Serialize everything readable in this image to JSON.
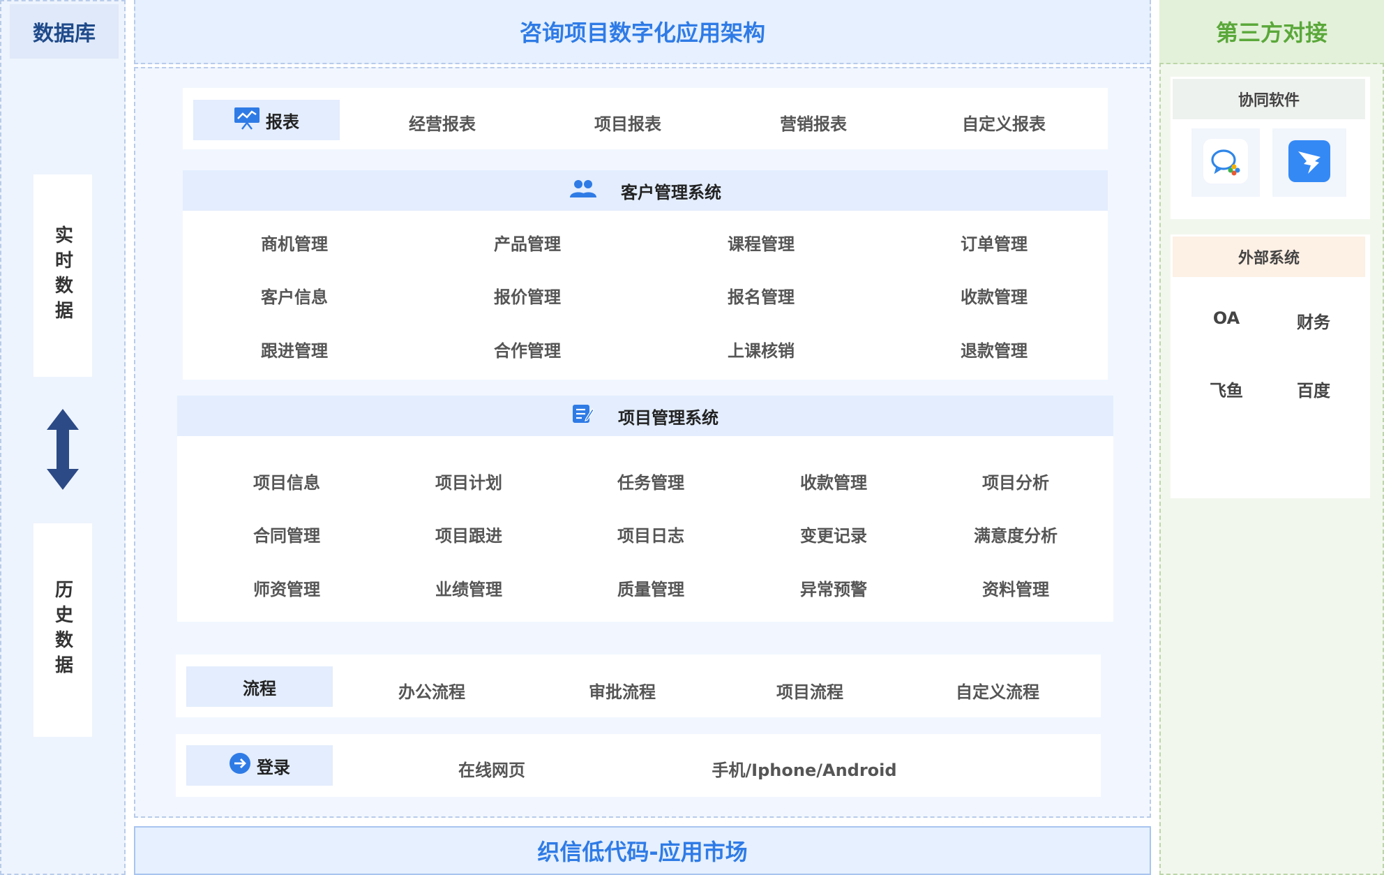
{
  "left": {
    "title": "数据库",
    "realtime": "实时数据",
    "history": "历史数据",
    "arrow_icon": "double-arrow-vertical-icon"
  },
  "center": {
    "title": "咨询项目数字化应用架构",
    "footer": "织信低代码-应用市场",
    "reports": {
      "icon": "presentation-chart-icon",
      "label": "报表",
      "items": [
        "经营报表",
        "项目报表",
        "营销报表",
        "自定义报表"
      ]
    },
    "crm": {
      "icon": "users-icon",
      "title": "客户管理系统",
      "rows": [
        [
          "商机管理",
          "产品管理",
          "课程管理",
          "订单管理"
        ],
        [
          "客户信息",
          "报价管理",
          "报名管理",
          "收款管理"
        ],
        [
          "跟进管理",
          "合作管理",
          "上课核销",
          "退款管理"
        ]
      ]
    },
    "pm": {
      "icon": "edit-list-icon",
      "title": "项目管理系统",
      "rows": [
        [
          "项目信息",
          "项目计划",
          "任务管理",
          "收款管理",
          "项目分析"
        ],
        [
          "合同管理",
          "项目跟进",
          "项目日志",
          "变更记录",
          "满意度分析"
        ],
        [
          "师资管理",
          "业绩管理",
          "质量管理",
          "异常预警",
          "资料管理"
        ]
      ]
    },
    "flow": {
      "label": "流程",
      "items": [
        "办公流程",
        "审批流程",
        "项目流程",
        "自定义流程"
      ]
    },
    "login": {
      "icon": "arrow-right-circle-icon",
      "label": "登录",
      "items": [
        "在线网页",
        "手机/Iphone/Android"
      ]
    }
  },
  "right": {
    "title": "第三方对接",
    "collab": {
      "title": "协同软件",
      "apps": [
        "wecom-icon",
        "dingtalk-icon"
      ]
    },
    "external": {
      "title": "外部系统",
      "items": [
        "OA",
        "财务",
        "飞鱼",
        "百度"
      ]
    }
  },
  "colors": {
    "accent_blue": "#2f7be6",
    "accent_green": "#5aa83a",
    "dark_navy": "#2c4a86"
  }
}
